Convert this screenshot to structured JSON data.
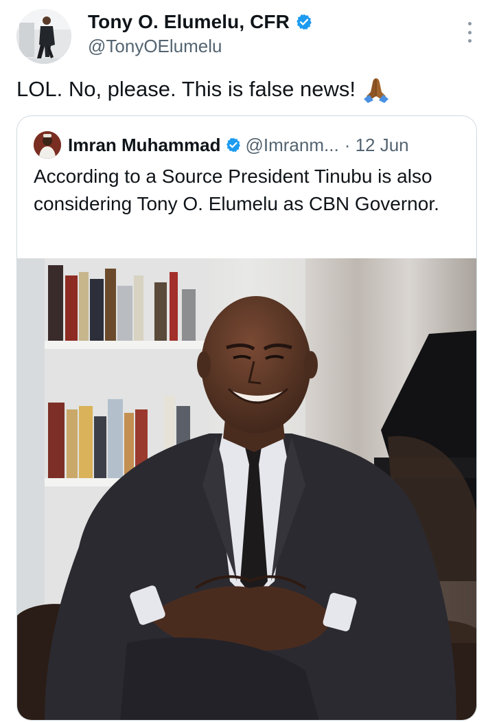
{
  "tweet": {
    "author": {
      "display_name": "Tony O. Elumelu, CFR",
      "handle": "@TonyOElumelu",
      "verified": true
    },
    "text": "LOL. No, please. This is false news!",
    "emoji": "folded-hands-emoji"
  },
  "quoted": {
    "display_name": "Imran Muhammad",
    "handle": "@Imranm...",
    "date": "· 12 Jun",
    "verified": true,
    "text": "According to a Source President Tinubu is also considering Tony O. Elumelu as CBN Governor."
  },
  "colors": {
    "verified_blue": "#1d9bf0",
    "text_primary": "#0f1419",
    "text_secondary": "#536471",
    "border": "#cfd9de"
  }
}
